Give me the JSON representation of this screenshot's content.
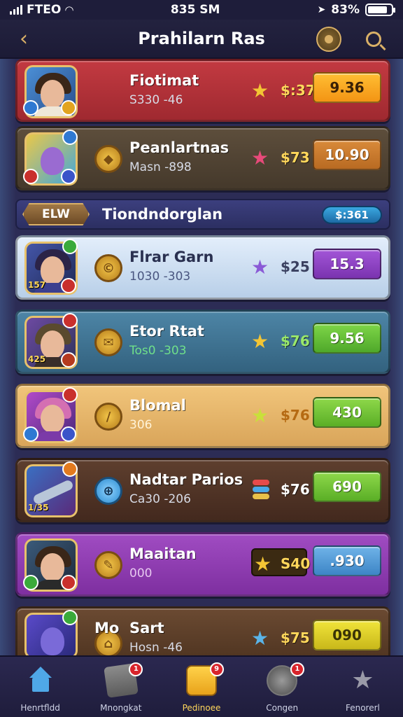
{
  "status": {
    "carrier": "FTEO",
    "time": "835 SM",
    "battery": "83%",
    "battery_level": 0.83
  },
  "header": {
    "title": "Prahilarn Ras"
  },
  "cards_top": [
    {
      "name": "Fiotimat",
      "sub": "S330 -46",
      "price": "$:37",
      "btn": "9.36",
      "star": "★"
    },
    {
      "name": "Peanlartnas",
      "sub": "Masn -898",
      "price": "$73",
      "btn": "10.90",
      "star": "★"
    }
  ],
  "section": {
    "tag": "ELW",
    "title": "Tiondndorglan",
    "value": "$:361"
  },
  "cards": [
    {
      "name": "Flrar Garn",
      "sub": "1030 -303",
      "price": "$25",
      "btn": "15.3",
      "avatar_num": "157",
      "star": "★"
    },
    {
      "name": "Etor Rtat",
      "sub": "Tos0 -303",
      "price": "$76",
      "btn": "9.56",
      "avatar_num": "425",
      "star": "★"
    },
    {
      "name": "Blomal",
      "sub": "306",
      "price": "$76",
      "btn": "430",
      "avatar_num": "",
      "star": "★"
    },
    {
      "name": "Nadtar Parios",
      "sub": "Ca30 -206",
      "price": "$76",
      "btn": "690",
      "avatar_num": "1/35",
      "star": ""
    },
    {
      "name": "Maaitan",
      "sub": "000",
      "price": "S40",
      "btn": ".930",
      "avatar_num": "",
      "star": "★"
    },
    {
      "name": "Sart",
      "name_prefix": "Mo",
      "sub": "Hosn -46",
      "price": "$75",
      "btn": "090",
      "avatar_num": "",
      "star": "★"
    }
  ],
  "tabs": [
    {
      "label": "Henrtfldd",
      "badge": ""
    },
    {
      "label": "Mnongkat",
      "badge": "1"
    },
    {
      "label": "Pedinoee",
      "badge": "9"
    },
    {
      "label": "Congen",
      "badge": "1"
    },
    {
      "label": "Fenorerl",
      "badge": ""
    }
  ],
  "colors": {
    "gold": "#ffd75b",
    "card_red": "#b8323a",
    "card_brown": "#4f4132",
    "card_lightblue": "#c9dbf0",
    "card_teal": "#3e6f8c",
    "card_gold": "#e3b56a",
    "card_darkbrown": "#4e3426",
    "card_purple": "#8c3ea9",
    "btn_orange": "#f7a21b",
    "btn_purple": "#8b43c5",
    "btn_green": "#5fbf2f",
    "btn_blue": "#4596d6",
    "btn_yellow": "#e2d91f"
  },
  "icons": {
    "back": "chevron-left-icon",
    "coin": "coin-icon",
    "search": "search-icon"
  }
}
